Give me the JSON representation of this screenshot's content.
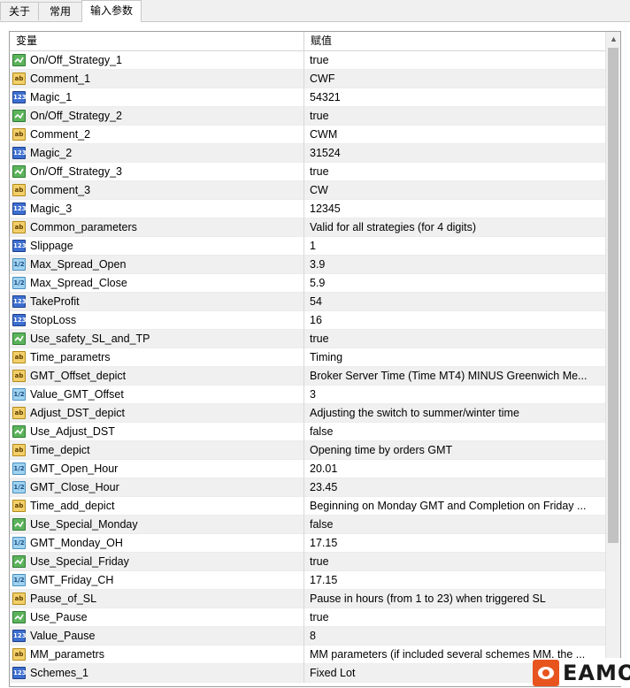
{
  "tabs": [
    "关于",
    "常用",
    "输入参数"
  ],
  "active_tab": 2,
  "table": {
    "columns": [
      "变量",
      "赋值"
    ],
    "rows": [
      {
        "type": "bool",
        "name": "On/Off_Strategy_1",
        "value": "true"
      },
      {
        "type": "string",
        "name": "Comment_1",
        "value": "CWF"
      },
      {
        "type": "int",
        "name": "Magic_1",
        "value": "54321"
      },
      {
        "type": "bool",
        "name": "On/Off_Strategy_2",
        "value": "true"
      },
      {
        "type": "string",
        "name": "Comment_2",
        "value": "CWM"
      },
      {
        "type": "int",
        "name": "Magic_2",
        "value": "31524"
      },
      {
        "type": "bool",
        "name": "On/Off_Strategy_3",
        "value": "true"
      },
      {
        "type": "string",
        "name": "Comment_3",
        "value": "CW"
      },
      {
        "type": "int",
        "name": "Magic_3",
        "value": "12345"
      },
      {
        "type": "string",
        "name": "Common_parameters",
        "value": "Valid for all strategies (for 4 digits)"
      },
      {
        "type": "int",
        "name": "Slippage",
        "value": "1"
      },
      {
        "type": "double",
        "name": "Max_Spread_Open",
        "value": "3.9"
      },
      {
        "type": "double",
        "name": "Max_Spread_Close",
        "value": "5.9"
      },
      {
        "type": "int",
        "name": "TakeProfit",
        "value": "54"
      },
      {
        "type": "int",
        "name": "StopLoss",
        "value": "16"
      },
      {
        "type": "bool",
        "name": "Use_safety_SL_and_TP",
        "value": "true"
      },
      {
        "type": "string",
        "name": "Time_parametrs",
        "value": "Timing"
      },
      {
        "type": "string",
        "name": "GMT_Offset_depict",
        "value": "Broker Server Time (Time MT4) MINUS  Greenwich Me..."
      },
      {
        "type": "double",
        "name": "Value_GMT_Offset",
        "value": "3"
      },
      {
        "type": "string",
        "name": "Adjust_DST_depict",
        "value": "Adjusting the switch to summer/winter time"
      },
      {
        "type": "bool",
        "name": "Use_Adjust_DST",
        "value": "false"
      },
      {
        "type": "string",
        "name": "Time_depict",
        "value": "Opening time by orders GMT"
      },
      {
        "type": "double",
        "name": "GMT_Open_Hour",
        "value": "20.01"
      },
      {
        "type": "double",
        "name": "GMT_Close_Hour",
        "value": "23.45"
      },
      {
        "type": "string",
        "name": "Time_add_depict",
        "value": "Beginning on Monday GMT and Completion on Friday ..."
      },
      {
        "type": "bool",
        "name": "Use_Special_Monday",
        "value": "false"
      },
      {
        "type": "double",
        "name": "GMT_Monday_OH",
        "value": "17.15"
      },
      {
        "type": "bool",
        "name": "Use_Special_Friday",
        "value": "true"
      },
      {
        "type": "double",
        "name": "GMT_Friday_CH",
        "value": "17.15"
      },
      {
        "type": "string",
        "name": "Pause_of_SL",
        "value": "Pause in hours (from 1 to 23) when triggered SL"
      },
      {
        "type": "bool",
        "name": "Use_Pause",
        "value": "true"
      },
      {
        "type": "int",
        "name": "Value_Pause",
        "value": "8"
      },
      {
        "type": "string",
        "name": "MM_parametrs",
        "value": "MM parameters (if included several schemes MM, the ..."
      },
      {
        "type": "int",
        "name": "Schemes_1",
        "value": "Fixed Lot"
      }
    ]
  },
  "icons": {
    "string": "ab",
    "int": "123",
    "double": "1/2",
    "bool": "bool-check-icon"
  },
  "watermark": {
    "brand": "EAMOL"
  }
}
